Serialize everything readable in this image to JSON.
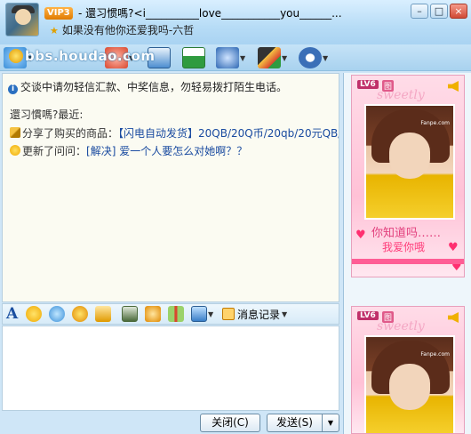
{
  "window": {
    "badge": "VIP3",
    "title": "- 還习惯嗎?<i__________love___________you______...",
    "subtitle": "如果没有他你还爱我吗-六哲",
    "controls": {
      "minimize": "–",
      "maximize": "□",
      "close": "×"
    }
  },
  "watermark": {
    "text": "bbs.houdao.com"
  },
  "toolbar": {
    "items": [
      {
        "name": "video-icon",
        "color": "#3a8fd8"
      },
      {
        "name": "audio-icon",
        "color": "#d9482f"
      },
      {
        "name": "email-icon",
        "color": "#4c8ed0"
      },
      {
        "name": "transfer-file-icon",
        "color": "#2f9b3f"
      },
      {
        "name": "remote-assist-icon",
        "color": "#2c67b3"
      },
      {
        "name": "app-center-icon",
        "color": "#b06a30"
      },
      {
        "name": "settings-icon",
        "color": "#3b6fb7"
      }
    ]
  },
  "chat": {
    "notice": "交谈中请勿轻信汇款、中奖信息，勿轻易拨打陌生电话。",
    "recent_title": "還习慣嗎?最近:",
    "line1_prefix": "分享了购买的商品：",
    "line1_link": "【闪电自动发货】20QB/20Q币/20qb/20元QB/...",
    "line2_prefix": "更新了问问：",
    "line2_link": "[解决] 爱一个人要怎么对她啊？？"
  },
  "format_toolbar": {
    "font_icon_label": "A",
    "message_record": "消息记录"
  },
  "buttons": {
    "close": "关闭(C)",
    "send": "发送(S)",
    "send_arrow": "▼"
  },
  "show_panel": {
    "level": "LV6",
    "tag": "图",
    "sweet": "sweetly",
    "photo_watermark": "Fanpe.com",
    "text1": "你知道吗……",
    "text2": "我爱你哦"
  }
}
